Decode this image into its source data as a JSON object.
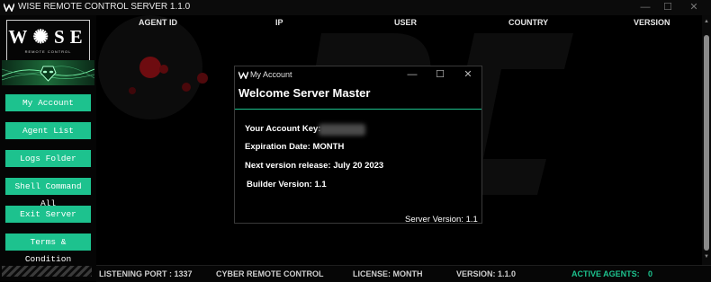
{
  "window": {
    "title": "WISE REMOTE CONTROL SERVER  1.1.0",
    "controls": {
      "minimize": "—",
      "maximize": "☐",
      "close": "✕"
    }
  },
  "sidebar": {
    "logo_letters": "W✺SE",
    "logo_subtitle": "REMOTE CONTROL",
    "buttons": [
      {
        "label": "My Account"
      },
      {
        "label": "Agent List"
      },
      {
        "label": "Logs Folder"
      },
      {
        "label": "Shell Command All"
      },
      {
        "label": "Exit Server"
      },
      {
        "label": "Terms & Condition"
      }
    ]
  },
  "table": {
    "columns": [
      "AGENT ID",
      "IP",
      "USER",
      "COUNTRY",
      "VERSION"
    ]
  },
  "status": {
    "listening_port": "LISTENING PORT :   1337",
    "cyber": "CYBER REMOTE CONTROL",
    "license": "LICENSE:   MONTH",
    "version": "VERSION:   1.1.0",
    "active_agents_label": "ACTIVE AGENTS:",
    "active_agents_value": "0"
  },
  "dialog": {
    "title": "My Account",
    "heading": "Welcome Server Master",
    "account_key_label": "Your Account Key:",
    "expiration": "Expiration Date: MONTH",
    "next_version": "Next version release: July 20 2023",
    "builder_version": "Builder Version: 1.1",
    "server_version": "Server Version: 1.1",
    "controls": {
      "minimize": "—",
      "maximize": "☐",
      "close": "✕"
    }
  },
  "colors": {
    "accent": "#1dc28e",
    "active_agents": "#1dc28e",
    "background": "#000000"
  },
  "icons": [
    "wise-logo-icon",
    "minimize-icon",
    "maximize-icon",
    "close-icon",
    "alien-banner-icon"
  ]
}
